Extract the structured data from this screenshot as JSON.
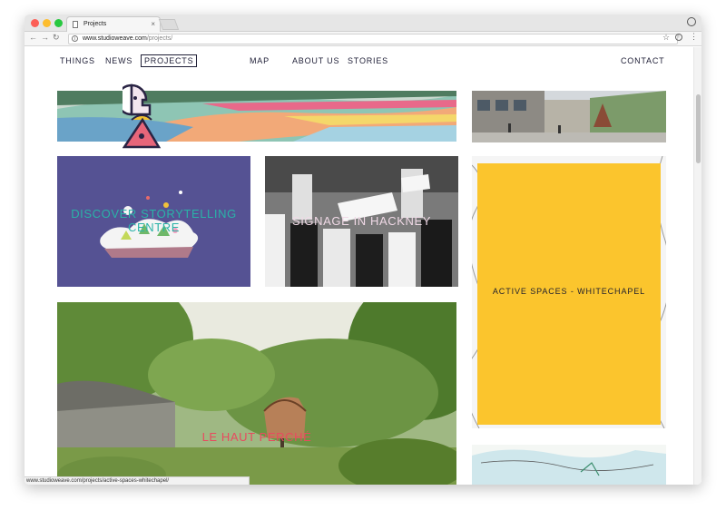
{
  "browser": {
    "tab_title": "Projects",
    "tab_close": "×",
    "url_host": "www.studioweave.com",
    "url_path": "/projects/",
    "status_url": "www.studioweave.com/projects/active-spaces-whitechapel/"
  },
  "site_nav": {
    "things": "THINGS",
    "news": "NEWS",
    "projects": "PROJECTS",
    "map": "MAP",
    "about": "ABOUT US",
    "stories": "STORIES",
    "contact": "CONTACT"
  },
  "projects": [
    {
      "title": "DISCOVER STORYTELLING CENTRE",
      "color": "#2ab3a8"
    },
    {
      "title": "SIGNAGE IN HACKNEY",
      "color": "#f0d9e6"
    },
    {
      "title": "ACTIVE SPACES - WHITECHAPEL",
      "color": "#1f1f2e"
    },
    {
      "title": "LE HAUT PERCHÉ",
      "color": "#e84a5f"
    }
  ],
  "colors": {
    "nav_text": "#1e1e36",
    "discover_bg": "#555293",
    "active_spaces_bg": "#fbc52d"
  }
}
